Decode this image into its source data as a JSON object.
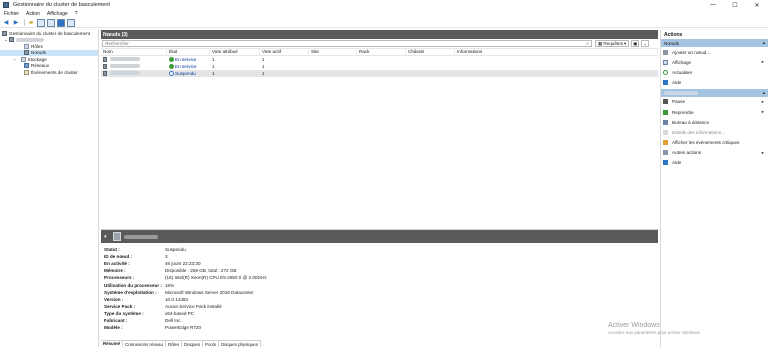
{
  "window": {
    "title": "Gestionnaire du cluster de basculement",
    "minimize": "—",
    "maximize": "☐",
    "close": "✕"
  },
  "menu": [
    "Fichier",
    "Action",
    "Affichage",
    "?"
  ],
  "tree": {
    "root": "Gestionnaire du cluster de basculement",
    "items": [
      "Rôles",
      "Nœuds",
      "Stockage",
      "Réseaux",
      "Événements de cluster"
    ]
  },
  "nodes_pane": {
    "title": "Nœuds (3)",
    "search_placeholder": "Rechercher",
    "requests_label": "Requêtes",
    "columns": [
      "Nom",
      "État",
      "Vote attribué",
      "Vote actif",
      "Site",
      "Rack",
      "Châssis",
      "Informations"
    ],
    "rows": [
      {
        "state": "En service",
        "state_kind": "up",
        "assigned_vote": "1",
        "active_vote": "1"
      },
      {
        "state": "En service",
        "state_kind": "up",
        "assigned_vote": "1",
        "active_vote": "1"
      },
      {
        "state": "Suspendu",
        "state_kind": "paused",
        "assigned_vote": "1",
        "active_vote": "1"
      }
    ]
  },
  "details": {
    "properties": [
      {
        "key": "Statut :",
        "value": "Suspendu"
      },
      {
        "key": "ID de nœud :",
        "value": "3"
      },
      {
        "key": "En activité :",
        "value": "46 jours 22:23:30"
      },
      {
        "key": "Mémoire :",
        "value": "Disponible : 259 GB, total : 272 GB"
      },
      {
        "key": "Processeurs :",
        "value": "(16) Intel(R) Xeon(R) CPU E5-2650 0 @ 2.00GHz"
      },
      {
        "key": "Utilisation du processeur :",
        "value": "16%"
      },
      {
        "key": "Système d'exploitation :",
        "value": "Microsoft Windows Server 2016 Datacenter"
      },
      {
        "key": "Version :",
        "value": "10.0.14393"
      },
      {
        "key": "Service Pack :",
        "value": "Aucun Service Pack installé"
      },
      {
        "key": "Type du système :",
        "value": "x64-based PC"
      },
      {
        "key": "Fabricant :",
        "value": "Dell Inc."
      },
      {
        "key": "Modèle :",
        "value": "PowerEdge R720"
      }
    ],
    "tabs": [
      "Résumé",
      "Connexions réseau",
      "Rôles",
      "Disques",
      "Pools",
      "Disques physiques"
    ]
  },
  "actions": {
    "title": "Actions",
    "section1": "Nœuds",
    "section1_items": [
      {
        "label": "Ajouter un nœud...",
        "icon": "add-node-icon",
        "submenu": false,
        "disabled": false
      },
      {
        "label": "Affichage",
        "icon": "view-icon",
        "submenu": true,
        "disabled": false
      },
      {
        "label": "Actualiser",
        "icon": "refresh-icon",
        "submenu": false,
        "disabled": false
      },
      {
        "label": "Aide",
        "icon": "help-icon",
        "submenu": false,
        "disabled": false
      }
    ],
    "section2_items": [
      {
        "label": "Pause",
        "icon": "pause-icon",
        "submenu": true,
        "disabled": false
      },
      {
        "label": "Reprendre",
        "icon": "resume-icon",
        "submenu": true,
        "disabled": false
      },
      {
        "label": "Bureau à distance",
        "icon": "remote-desktop-icon",
        "submenu": false,
        "disabled": false
      },
      {
        "label": "Détails des informations...",
        "icon": "details-icon",
        "submenu": false,
        "disabled": true
      },
      {
        "label": "Afficher les événements critiques",
        "icon": "events-icon",
        "submenu": false,
        "disabled": false
      },
      {
        "label": "Autres actions",
        "icon": "more-actions-icon",
        "submenu": true,
        "disabled": false
      },
      {
        "label": "Aide",
        "icon": "help-icon",
        "submenu": false,
        "disabled": false
      }
    ]
  },
  "watermark": {
    "line1": "Activer Windows",
    "line2": "Accédez aux paramètres pour activer Windows."
  }
}
